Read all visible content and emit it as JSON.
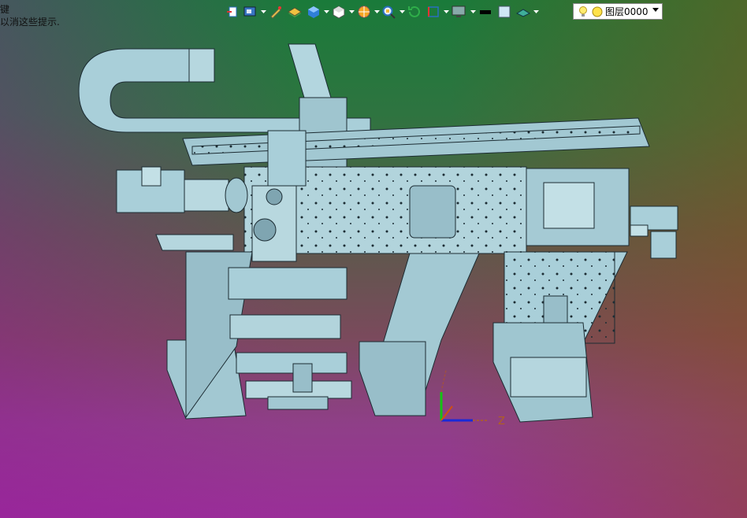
{
  "hint": {
    "line1": "键",
    "line2": "以消这些提示."
  },
  "toolbar": {
    "buttons": [
      {
        "icon": "view-orient-icon"
      },
      {
        "icon": "display-style-icon",
        "dropdown": true
      },
      {
        "icon": "edit-appearance-icon"
      },
      {
        "icon": "apply-scene-icon"
      },
      {
        "icon": "view-cube-icon",
        "dropdown": true
      },
      {
        "icon": "hide-show-icon",
        "dropdown": true
      },
      {
        "icon": "section-view-icon",
        "dropdown": true
      },
      {
        "icon": "zoom-icon",
        "dropdown": true
      },
      {
        "icon": "rotate-view-icon"
      },
      {
        "icon": "sketch-plane-icon",
        "dropdown": true
      },
      {
        "icon": "monitor-icon",
        "dropdown": true
      },
      {
        "icon": "color-black-icon"
      },
      {
        "icon": "color-light-icon"
      },
      {
        "icon": "surface-icon",
        "dropdown": true
      }
    ]
  },
  "layer": {
    "label": "图层0000"
  },
  "triad": {
    "z_label": "Z"
  },
  "colors": {
    "part": "#a9cfd9",
    "part_shadow": "#7fa5b1",
    "edge": "#1c2c33"
  }
}
